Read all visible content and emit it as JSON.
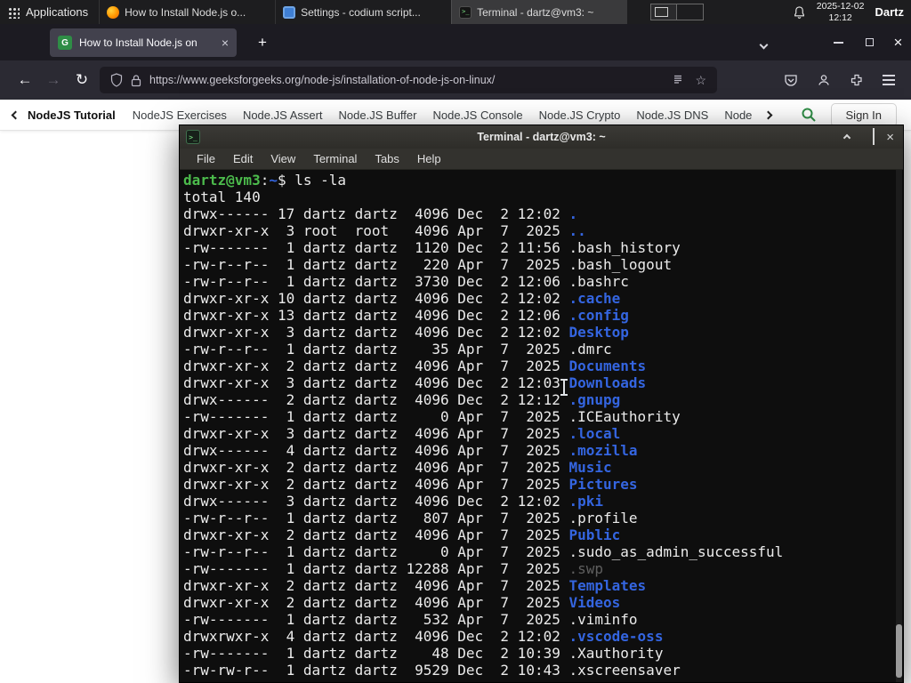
{
  "colors": {
    "gfg_green": "#2f8d46",
    "terminal_dir_blue": "#3465e0",
    "terminal_prompt_green": "#4cbb4c",
    "terminal_dim_gray": "#5f5f5f",
    "panel_bg": "#1d1d1f",
    "browser_dark": "#1c1b22"
  },
  "icons": {
    "back": "←",
    "forward": "→",
    "reload": "↻",
    "star": "☆",
    "new_tab": "+",
    "close": "×",
    "gfg_letter": "G",
    "terminal_glyph": ">_"
  },
  "panel": {
    "applications_label": "Applications",
    "taskbar": [
      {
        "title": "How to Install Node.js o...",
        "icon": "firefox",
        "active": false
      },
      {
        "title": "Settings - codium script...",
        "icon": "settings",
        "active": false
      },
      {
        "title": "Terminal - dartz@vm3: ~",
        "icon": "terminal",
        "active": true
      }
    ],
    "clock_date": "2025-12-02",
    "clock_time": "12:12",
    "user_label": "Dartz"
  },
  "browser": {
    "tab_title": "How to Install Node.js on",
    "url": "https://www.geeksforgeeks.org/node-js/installation-of-node-js-on-linux/"
  },
  "site_nav": {
    "back_label": "NodeJS Tutorial",
    "items": [
      "NodeJS Exercises",
      "Node.JS Assert",
      "Node.JS Buffer",
      "Node.JS Console",
      "Node.JS Crypto",
      "Node.JS DNS",
      "Node"
    ],
    "sign_in_label": "Sign In"
  },
  "terminal": {
    "window_title": "Terminal - dartz@vm3: ~",
    "menu_items": [
      "File",
      "Edit",
      "View",
      "Terminal",
      "Tabs",
      "Help"
    ],
    "prompt_user_host": "dartz@vm3",
    "prompt_colon": ":",
    "prompt_path": "~",
    "prompt_suffix": "$ ",
    "command": "ls -la",
    "total_line": "total 140",
    "entries": [
      {
        "meta": "drwx------ 17 dartz dartz  4096 Dec  2 12:02 ",
        "name": ".",
        "type": "dir"
      },
      {
        "meta": "drwxr-xr-x  3 root  root   4096 Apr  7  2025 ",
        "name": "..",
        "type": "dir"
      },
      {
        "meta": "-rw-------  1 dartz dartz  1120 Dec  2 11:56 ",
        "name": ".bash_history",
        "type": "file"
      },
      {
        "meta": "-rw-r--r--  1 dartz dartz   220 Apr  7  2025 ",
        "name": ".bash_logout",
        "type": "file"
      },
      {
        "meta": "-rw-r--r--  1 dartz dartz  3730 Dec  2 12:06 ",
        "name": ".bashrc",
        "type": "file"
      },
      {
        "meta": "drwxr-xr-x 10 dartz dartz  4096 Dec  2 12:02 ",
        "name": ".cache",
        "type": "dir"
      },
      {
        "meta": "drwxr-xr-x 13 dartz dartz  4096 Dec  2 12:06 ",
        "name": ".config",
        "type": "dir"
      },
      {
        "meta": "drwxr-xr-x  3 dartz dartz  4096 Dec  2 12:02 ",
        "name": "Desktop",
        "type": "dir"
      },
      {
        "meta": "-rw-r--r--  1 dartz dartz    35 Apr  7  2025 ",
        "name": ".dmrc",
        "type": "file"
      },
      {
        "meta": "drwxr-xr-x  2 dartz dartz  4096 Apr  7  2025 ",
        "name": "Documents",
        "type": "dir"
      },
      {
        "meta": "drwxr-xr-x  3 dartz dartz  4096 Dec  2 12:03 ",
        "name": "Downloads",
        "type": "dir"
      },
      {
        "meta": "drwx------  2 dartz dartz  4096 Dec  2 12:12 ",
        "name": ".gnupg",
        "type": "dir"
      },
      {
        "meta": "-rw-------  1 dartz dartz     0 Apr  7  2025 ",
        "name": ".ICEauthority",
        "type": "file"
      },
      {
        "meta": "drwxr-xr-x  3 dartz dartz  4096 Apr  7  2025 ",
        "name": ".local",
        "type": "dir"
      },
      {
        "meta": "drwx------  4 dartz dartz  4096 Apr  7  2025 ",
        "name": ".mozilla",
        "type": "dir"
      },
      {
        "meta": "drwxr-xr-x  2 dartz dartz  4096 Apr  7  2025 ",
        "name": "Music",
        "type": "dir"
      },
      {
        "meta": "drwxr-xr-x  2 dartz dartz  4096 Apr  7  2025 ",
        "name": "Pictures",
        "type": "dir"
      },
      {
        "meta": "drwx------  3 dartz dartz  4096 Dec  2 12:02 ",
        "name": ".pki",
        "type": "dir"
      },
      {
        "meta": "-rw-r--r--  1 dartz dartz   807 Apr  7  2025 ",
        "name": ".profile",
        "type": "file"
      },
      {
        "meta": "drwxr-xr-x  2 dartz dartz  4096 Apr  7  2025 ",
        "name": "Public",
        "type": "dir"
      },
      {
        "meta": "-rw-r--r--  1 dartz dartz     0 Apr  7  2025 ",
        "name": ".sudo_as_admin_successful",
        "type": "file"
      },
      {
        "meta": "-rw-------  1 dartz dartz 12288 Apr  7  2025 ",
        "name": ".swp",
        "type": "dim"
      },
      {
        "meta": "drwxr-xr-x  2 dartz dartz  4096 Apr  7  2025 ",
        "name": "Templates",
        "type": "dir"
      },
      {
        "meta": "drwxr-xr-x  2 dartz dartz  4096 Apr  7  2025 ",
        "name": "Videos",
        "type": "dir"
      },
      {
        "meta": "-rw-------  1 dartz dartz   532 Apr  7  2025 ",
        "name": ".viminfo",
        "type": "file"
      },
      {
        "meta": "drwxrwxr-x  4 dartz dartz  4096 Dec  2 12:02 ",
        "name": ".vscode-oss",
        "type": "dir"
      },
      {
        "meta": "-rw-------  1 dartz dartz    48 Dec  2 10:39 ",
        "name": ".Xauthority",
        "type": "file"
      },
      {
        "meta": "-rw-rw-r--  1 dartz dartz  9529 Dec  2 10:43 ",
        "name": ".xscreensaver",
        "type": "file"
      }
    ]
  }
}
